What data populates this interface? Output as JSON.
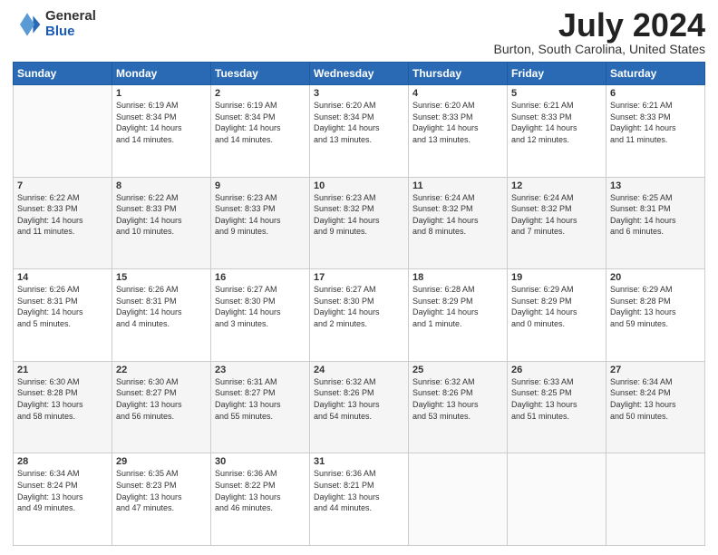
{
  "header": {
    "logo_general": "General",
    "logo_blue": "Blue",
    "title": "July 2024",
    "location": "Burton, South Carolina, United States"
  },
  "days_header": [
    "Sunday",
    "Monday",
    "Tuesday",
    "Wednesday",
    "Thursday",
    "Friday",
    "Saturday"
  ],
  "weeks": [
    [
      {
        "day": "",
        "text": ""
      },
      {
        "day": "1",
        "text": "Sunrise: 6:19 AM\nSunset: 8:34 PM\nDaylight: 14 hours\nand 14 minutes."
      },
      {
        "day": "2",
        "text": "Sunrise: 6:19 AM\nSunset: 8:34 PM\nDaylight: 14 hours\nand 14 minutes."
      },
      {
        "day": "3",
        "text": "Sunrise: 6:20 AM\nSunset: 8:34 PM\nDaylight: 14 hours\nand 13 minutes."
      },
      {
        "day": "4",
        "text": "Sunrise: 6:20 AM\nSunset: 8:33 PM\nDaylight: 14 hours\nand 13 minutes."
      },
      {
        "day": "5",
        "text": "Sunrise: 6:21 AM\nSunset: 8:33 PM\nDaylight: 14 hours\nand 12 minutes."
      },
      {
        "day": "6",
        "text": "Sunrise: 6:21 AM\nSunset: 8:33 PM\nDaylight: 14 hours\nand 11 minutes."
      }
    ],
    [
      {
        "day": "7",
        "text": "Sunrise: 6:22 AM\nSunset: 8:33 PM\nDaylight: 14 hours\nand 11 minutes."
      },
      {
        "day": "8",
        "text": "Sunrise: 6:22 AM\nSunset: 8:33 PM\nDaylight: 14 hours\nand 10 minutes."
      },
      {
        "day": "9",
        "text": "Sunrise: 6:23 AM\nSunset: 8:33 PM\nDaylight: 14 hours\nand 9 minutes."
      },
      {
        "day": "10",
        "text": "Sunrise: 6:23 AM\nSunset: 8:32 PM\nDaylight: 14 hours\nand 9 minutes."
      },
      {
        "day": "11",
        "text": "Sunrise: 6:24 AM\nSunset: 8:32 PM\nDaylight: 14 hours\nand 8 minutes."
      },
      {
        "day": "12",
        "text": "Sunrise: 6:24 AM\nSunset: 8:32 PM\nDaylight: 14 hours\nand 7 minutes."
      },
      {
        "day": "13",
        "text": "Sunrise: 6:25 AM\nSunset: 8:31 PM\nDaylight: 14 hours\nand 6 minutes."
      }
    ],
    [
      {
        "day": "14",
        "text": "Sunrise: 6:26 AM\nSunset: 8:31 PM\nDaylight: 14 hours\nand 5 minutes."
      },
      {
        "day": "15",
        "text": "Sunrise: 6:26 AM\nSunset: 8:31 PM\nDaylight: 14 hours\nand 4 minutes."
      },
      {
        "day": "16",
        "text": "Sunrise: 6:27 AM\nSunset: 8:30 PM\nDaylight: 14 hours\nand 3 minutes."
      },
      {
        "day": "17",
        "text": "Sunrise: 6:27 AM\nSunset: 8:30 PM\nDaylight: 14 hours\nand 2 minutes."
      },
      {
        "day": "18",
        "text": "Sunrise: 6:28 AM\nSunset: 8:29 PM\nDaylight: 14 hours\nand 1 minute."
      },
      {
        "day": "19",
        "text": "Sunrise: 6:29 AM\nSunset: 8:29 PM\nDaylight: 14 hours\nand 0 minutes."
      },
      {
        "day": "20",
        "text": "Sunrise: 6:29 AM\nSunset: 8:28 PM\nDaylight: 13 hours\nand 59 minutes."
      }
    ],
    [
      {
        "day": "21",
        "text": "Sunrise: 6:30 AM\nSunset: 8:28 PM\nDaylight: 13 hours\nand 58 minutes."
      },
      {
        "day": "22",
        "text": "Sunrise: 6:30 AM\nSunset: 8:27 PM\nDaylight: 13 hours\nand 56 minutes."
      },
      {
        "day": "23",
        "text": "Sunrise: 6:31 AM\nSunset: 8:27 PM\nDaylight: 13 hours\nand 55 minutes."
      },
      {
        "day": "24",
        "text": "Sunrise: 6:32 AM\nSunset: 8:26 PM\nDaylight: 13 hours\nand 54 minutes."
      },
      {
        "day": "25",
        "text": "Sunrise: 6:32 AM\nSunset: 8:26 PM\nDaylight: 13 hours\nand 53 minutes."
      },
      {
        "day": "26",
        "text": "Sunrise: 6:33 AM\nSunset: 8:25 PM\nDaylight: 13 hours\nand 51 minutes."
      },
      {
        "day": "27",
        "text": "Sunrise: 6:34 AM\nSunset: 8:24 PM\nDaylight: 13 hours\nand 50 minutes."
      }
    ],
    [
      {
        "day": "28",
        "text": "Sunrise: 6:34 AM\nSunset: 8:24 PM\nDaylight: 13 hours\nand 49 minutes."
      },
      {
        "day": "29",
        "text": "Sunrise: 6:35 AM\nSunset: 8:23 PM\nDaylight: 13 hours\nand 47 minutes."
      },
      {
        "day": "30",
        "text": "Sunrise: 6:36 AM\nSunset: 8:22 PM\nDaylight: 13 hours\nand 46 minutes."
      },
      {
        "day": "31",
        "text": "Sunrise: 6:36 AM\nSunset: 8:21 PM\nDaylight: 13 hours\nand 44 minutes."
      },
      {
        "day": "",
        "text": ""
      },
      {
        "day": "",
        "text": ""
      },
      {
        "day": "",
        "text": ""
      }
    ]
  ]
}
